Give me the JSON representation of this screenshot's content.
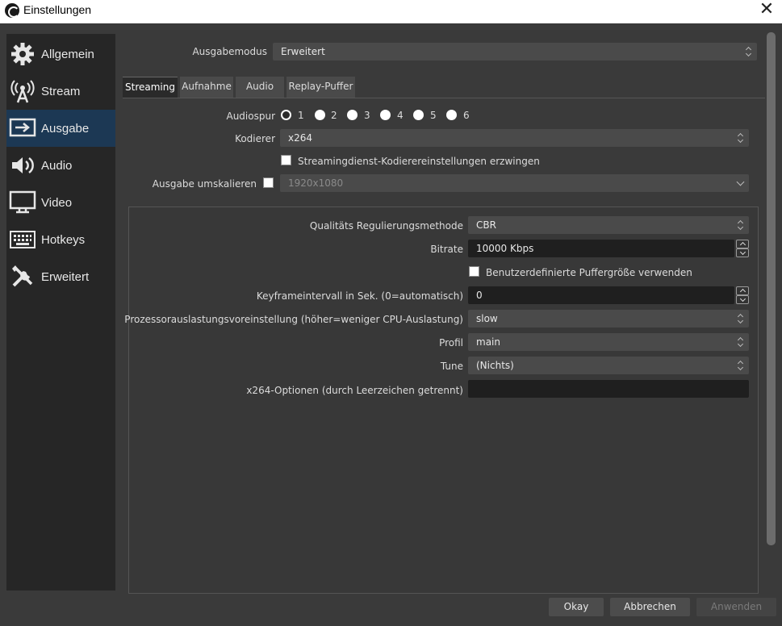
{
  "window": {
    "title": "Einstellungen"
  },
  "sidebar": {
    "items": [
      {
        "label": "Allgemein",
        "icon": "gear-icon"
      },
      {
        "label": "Stream",
        "icon": "antenna-icon"
      },
      {
        "label": "Ausgabe",
        "icon": "output-icon",
        "active": true
      },
      {
        "label": "Audio",
        "icon": "speaker-icon"
      },
      {
        "label": "Video",
        "icon": "monitor-icon"
      },
      {
        "label": "Hotkeys",
        "icon": "keyboard-icon"
      },
      {
        "label": "Erweitert",
        "icon": "tools-icon"
      }
    ]
  },
  "output_mode": {
    "label": "Ausgabemodus",
    "value": "Erweitert"
  },
  "tabs": [
    {
      "label": "Streaming",
      "active": true
    },
    {
      "label": "Aufnahme"
    },
    {
      "label": "Audio"
    },
    {
      "label": "Replay-Puffer"
    }
  ],
  "streaming": {
    "audiospur_label": "Audiospur",
    "tracks": [
      "1",
      "2",
      "3",
      "4",
      "5",
      "6"
    ],
    "selected_track": "1",
    "encoder_label": "Kodierer",
    "encoder_value": "x264",
    "enforce_label": "Streamingdienst-Kodierereinstellungen erzwingen",
    "rescale_label": "Ausgabe umskalieren",
    "rescale_value": "1920x1080",
    "rate_control_label": "Qualitäts Regulierungsmethode",
    "rate_control_value": "CBR",
    "bitrate_label": "Bitrate",
    "bitrate_value": "10000 Kbps",
    "custom_buffer_label": "Benutzerdefinierte Puffergröße verwenden",
    "keyframe_label": "Keyframeintervall in Sek. (0=automatisch)",
    "keyframe_value": "0",
    "preset_label": "Prozessorauslastungsvoreinstellung (höher=weniger CPU-Auslastung)",
    "preset_value": "slow",
    "profile_label": "Profil",
    "profile_value": "main",
    "tune_label": "Tune",
    "tune_value": "(Nichts)",
    "options_label": "x264-Optionen (durch Leerzeichen getrennt)",
    "options_value": ""
  },
  "buttons": {
    "ok": "Okay",
    "cancel": "Abbrechen",
    "apply": "Anwenden"
  },
  "colors": {
    "accent": "#1c3854",
    "background": "#3a3a3a",
    "sidebar": "#262626"
  }
}
